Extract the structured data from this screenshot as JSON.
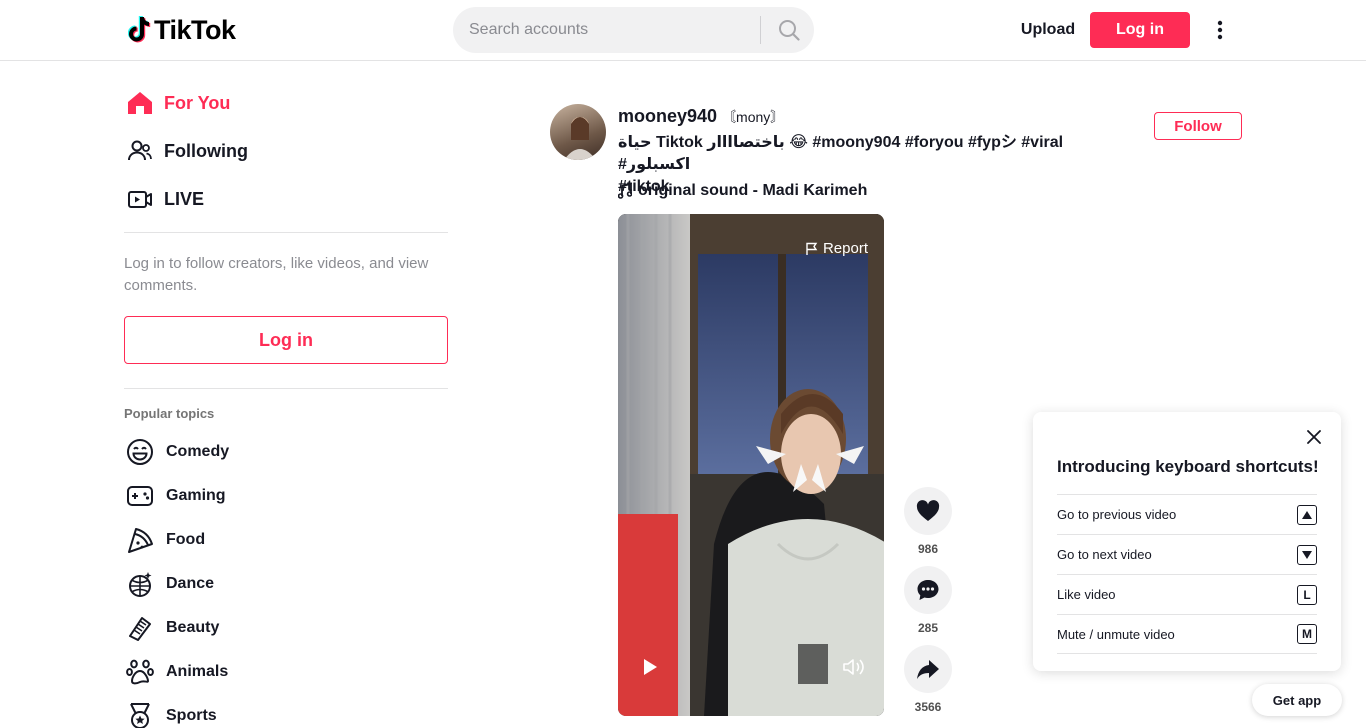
{
  "header": {
    "logo_text": "TikTok",
    "search_placeholder": "Search accounts",
    "upload_label": "Upload",
    "login_label": "Log in"
  },
  "sidebar": {
    "nav": [
      {
        "label": "For You",
        "icon": "home-icon",
        "active": true
      },
      {
        "label": "Following",
        "icon": "people-icon",
        "active": false
      },
      {
        "label": "LIVE",
        "icon": "live-icon",
        "active": false
      }
    ],
    "login_prompt": "Log in to follow creators, like videos, and view comments.",
    "login_button": "Log in",
    "topics_title": "Popular topics",
    "topics": [
      {
        "label": "Comedy",
        "icon": "smiley-icon"
      },
      {
        "label": "Gaming",
        "icon": "gamepad-icon"
      },
      {
        "label": "Food",
        "icon": "pizza-icon"
      },
      {
        "label": "Dance",
        "icon": "disco-ball-icon"
      },
      {
        "label": "Beauty",
        "icon": "comb-icon"
      },
      {
        "label": "Animals",
        "icon": "paw-icon"
      },
      {
        "label": "Sports",
        "icon": "medal-icon"
      }
    ]
  },
  "post": {
    "username": "mooney940",
    "nickname": "mony",
    "caption_line1": "حياة Tiktok باختصاااار 😂 #moony904 #foryou #fypシ #viral #اكسبلور",
    "caption_line2": "#tiktok",
    "music": "original sound - Madi Karimeh",
    "follow_label": "Follow",
    "report_label": "Report",
    "likes": "986",
    "comments": "285",
    "shares": "3566"
  },
  "shortcuts": {
    "title": "Introducing keyboard shortcuts!",
    "rows": [
      {
        "label": "Go to previous video",
        "key": "▲"
      },
      {
        "label": "Go to next video",
        "key": "▼"
      },
      {
        "label": "Like video",
        "key": "L"
      },
      {
        "label": "Mute / unmute video",
        "key": "M"
      }
    ]
  },
  "get_app_label": "Get app",
  "colors": {
    "accent": "#fe2c55",
    "text": "#161823",
    "muted": "#8a8b91"
  }
}
